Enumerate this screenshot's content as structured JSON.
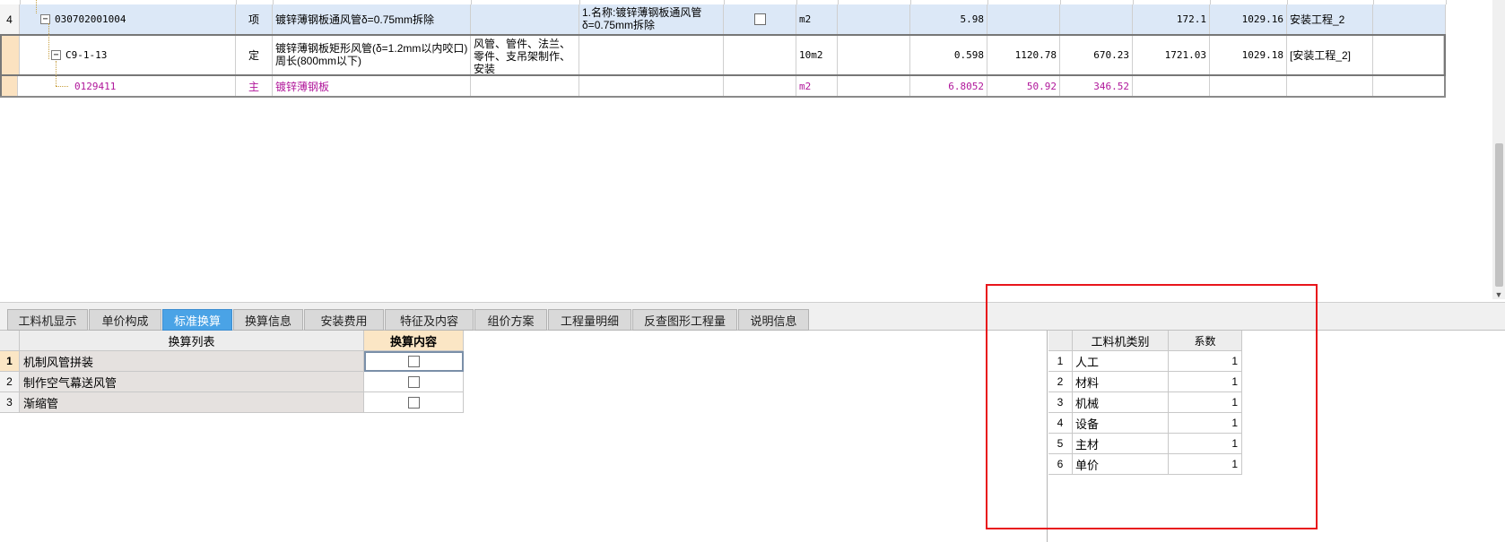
{
  "grid": {
    "rows": [
      {
        "num": "4",
        "code": "030702001004",
        "type": "项",
        "name": "镀锌薄钢板通风管δ=0.75mm拆除",
        "content": "",
        "feature": "1.名称:镀锌薄钢板通风管δ=0.75mm拆除",
        "unit": "m2",
        "qty_expr": "",
        "qty": "5.98",
        "price1": "",
        "price2": "",
        "total": "172.1",
        "price3": "1029.16",
        "project": "安装工程_2"
      },
      {
        "num": "",
        "code": "C9-1-13",
        "type": "定",
        "name": "镀锌薄钢板矩形风管(δ=1.2mm以内咬口)周长(800mm以下)",
        "content": "风管、管件、法兰、零件、支吊架制作、安装",
        "feature": "",
        "unit": "10m2",
        "qty_expr": "",
        "qty": "0.598",
        "price1": "1120.78",
        "price2": "670.23",
        "total": "1721.03",
        "price3": "1029.18",
        "project": "[安装工程_2]"
      },
      {
        "num": "",
        "code": "0129411",
        "type": "主",
        "name": "镀锌薄钢板",
        "content": "",
        "feature": "",
        "unit": "m2",
        "qty_expr": "",
        "qty": "6.8052",
        "price1": "50.92",
        "price2": "346.52",
        "total": "",
        "price3": "",
        "project": ""
      }
    ]
  },
  "tabs": [
    "工料机显示",
    "单价构成",
    "标准换算",
    "换算信息",
    "安装费用",
    "特征及内容",
    "组价方案",
    "工程量明细",
    "反查图形工程量",
    "说明信息"
  ],
  "active_tab": "标准换算",
  "conversion": {
    "header_list": "换算列表",
    "header_content": "换算内容",
    "items": [
      {
        "num": "1",
        "name": "机制风管拼装"
      },
      {
        "num": "2",
        "name": "制作空气幕送风管"
      },
      {
        "num": "3",
        "name": "渐缩管"
      }
    ]
  },
  "coefficients": {
    "header_category": "工料机类别",
    "header_coef": "系数",
    "items": [
      {
        "num": "1",
        "category": "人工",
        "coef": "1"
      },
      {
        "num": "2",
        "category": "材料",
        "coef": "1"
      },
      {
        "num": "3",
        "category": "机械",
        "coef": "1"
      },
      {
        "num": "4",
        "category": "设备",
        "coef": "1"
      },
      {
        "num": "5",
        "category": "主材",
        "coef": "1"
      },
      {
        "num": "6",
        "category": "单价",
        "coef": "1"
      }
    ]
  },
  "colors": {
    "accent_tab": "#4aa3e6",
    "selected_row": "#dce8f7",
    "material_text": "#b0169a",
    "highlight_box": "#e8141b"
  }
}
